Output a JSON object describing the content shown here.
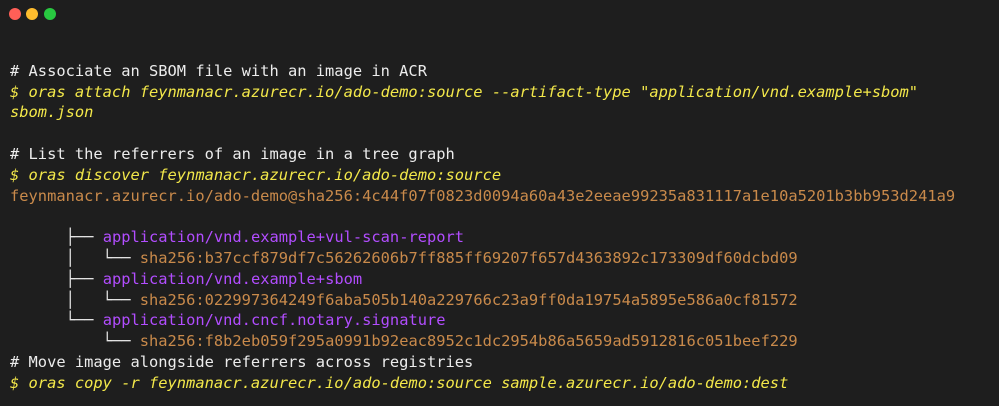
{
  "window": {
    "controls": [
      "close",
      "minimize",
      "maximize"
    ]
  },
  "terminal": {
    "lines": [
      {
        "kind": "blank",
        "text": ""
      },
      {
        "kind": "comment",
        "text": "# Associate an SBOM file with an image in ACR"
      },
      {
        "kind": "cmd",
        "text": "$ oras attach feynmanacr.azurecr.io/ado-demo:source --artifact-type \"application/vnd.example+sbom\""
      },
      {
        "kind": "cmd",
        "text": "sbom.json"
      },
      {
        "kind": "blank",
        "text": ""
      },
      {
        "kind": "comment",
        "text": "# List the referrers of an image in a tree graph"
      },
      {
        "kind": "cmd",
        "text": "$ oras discover feynmanacr.azurecr.io/ado-demo:source"
      },
      {
        "kind": "root",
        "text": "feynmanacr.azurecr.io/ado-demo@sha256:4c44f07f0823d0094a60a43e2eeae99235a831117a1e10a5201b3bb953d241a9"
      },
      {
        "kind": "tree",
        "prefix": "├── ",
        "text": "application/vnd.example+vul-scan-report",
        "style": "atype"
      },
      {
        "kind": "tree",
        "prefix": "│   └── ",
        "text": "sha256:b37ccf879df7c56262606b7ff885ff69207f657d4363892c173309df60dcbd09",
        "style": "digest"
      },
      {
        "kind": "tree",
        "prefix": "├── ",
        "text": "application/vnd.example+sbom",
        "style": "atype"
      },
      {
        "kind": "tree",
        "prefix": "│   └── ",
        "text": "sha256:022997364249f6aba505b140a229766c23a9ff0da19754a5895e586a0cf81572",
        "style": "digest"
      },
      {
        "kind": "tree",
        "prefix": "└── ",
        "text": "application/vnd.cncf.notary.signature",
        "style": "atype"
      },
      {
        "kind": "tree",
        "prefix": "    └── ",
        "text": "sha256:f8b2eb059f295a0991b92eac8952c1dc2954b86a5659ad5912816c051beef229",
        "style": "digest"
      },
      {
        "kind": "blank",
        "text": ""
      },
      {
        "kind": "comment",
        "text": "# Move image alongside referrers across registries"
      },
      {
        "kind": "cmd",
        "text": "$ oras copy -r feynmanacr.azurecr.io/ado-demo:source sample.azurecr.io/ado-demo:dest"
      }
    ]
  }
}
